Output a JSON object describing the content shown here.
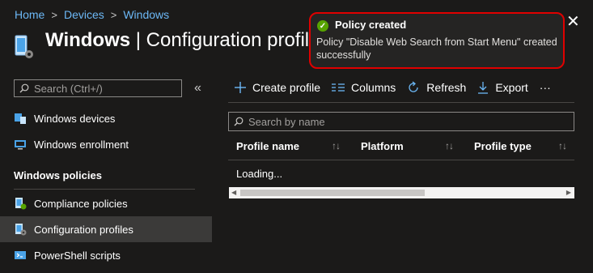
{
  "breadcrumb": {
    "items": [
      "Home",
      "Devices",
      "Windows"
    ]
  },
  "page": {
    "title_bold": "Windows",
    "title_rest": " | Configuration profil"
  },
  "sidebar": {
    "search_placeholder": "Search (Ctrl+/)",
    "collapse_glyph": "«",
    "items_top": [
      {
        "label": "Windows devices",
        "icon": "windows-devices-icon"
      },
      {
        "label": "Windows enrollment",
        "icon": "enrollment-icon"
      }
    ],
    "section_label": "Windows policies",
    "items_policies": [
      {
        "label": "Compliance policies",
        "icon": "compliance-icon"
      },
      {
        "label": "Configuration profiles",
        "icon": "configuration-icon",
        "selected": true
      },
      {
        "label": "PowerShell scripts",
        "icon": "powershell-icon"
      }
    ]
  },
  "toolbar": {
    "create": "Create profile",
    "columns": "Columns",
    "refresh": "Refresh",
    "export": "Export",
    "more": "···"
  },
  "table": {
    "search_placeholder": "Search by name",
    "columns": [
      "Profile name",
      "Platform",
      "Profile type"
    ],
    "status": "Loading..."
  },
  "toast": {
    "title": "Policy created",
    "message": "Policy \"Disable Web Search from Start Menu\" created successfully",
    "close": "✕"
  },
  "colors": {
    "accent": "#6cb8f6",
    "success": "#57a300",
    "toast_border": "#e00000"
  }
}
